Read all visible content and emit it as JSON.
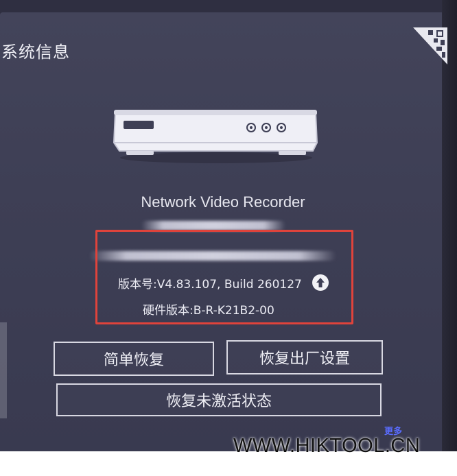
{
  "window": {
    "title": "系统信息"
  },
  "device": {
    "product_name": "Network Video Recorder"
  },
  "info": {
    "firmware_version": "版本号:V4.83.107, Build 260127",
    "hardware_version": "硬件版本:B-R-K21B2-00"
  },
  "buttons": {
    "simple_restore": "简单恢复",
    "factory_reset": "恢复出厂设置",
    "restore_inactive": "恢复未激活状态"
  },
  "more_link": "更多",
  "watermark": "WWW.HIKTOOL.CN",
  "icons": {
    "qr": "qr-code-icon",
    "device": "nvr-device-icon",
    "upgrade": "upgrade-arrow-icon"
  },
  "colors": {
    "background": "#3e3f55",
    "highlight_border": "#e0433b",
    "text": "#ececf4",
    "link": "#5a6cff"
  }
}
